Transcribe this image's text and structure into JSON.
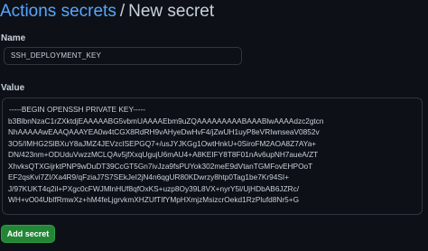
{
  "header": {
    "breadcrumb_link": "Actions secrets",
    "separator": "/",
    "current_page": "New secret"
  },
  "form": {
    "name_label": "Name",
    "name_value": "SSH_DEPLOYMENT_KEY",
    "value_label": "Value",
    "value_lines": [
      "-----BEGIN OPENSSH PRIVATE KEY-----",
      "b3BlbnNzaC1rZXktdjEAAAAABG5vbmUAAAAEbm9uZQAAAAAAAAABAAABlwAAAAdzc2gtcn",
      "NhAAAAAwEAAQAAAYEA0w4tCGX8RdRH9vAHyeDwHvF4/jZwUH1uyP8eVRIwnseaV0852v",
      "3O5/IMHG2SlBXuY8aJMZ4JEVzcISEPGQ7+/usJYJKGg1OwtHnkU+0SiroFM2AOA8Z7AYa+",
      "DN/423nm+ODUduVwzzMCLQAv5jfXxqUgujU6mAU4+A8KEIFY8T8F01nAv6upNH7aueA/ZT",
      "XhvksQTXGijrktPNP9wDuDT39CcGT5Gn7ivJza9fsPUYok302meE9dVtanTGMFovEHPOoT",
      "EF2qsKvi7ZI/Xa4R9/qFziaJ7S7SEkJeI2jN4n6qgUR80KDwrzy8htp0Tag1be7Kr94SI+",
      "J/97KUKT4q2il+PXgc0cFWJMlnHUf8qfOxKS+uzp8Oy39L8VX+nyrY5l/UjHDbAB6JZRc/",
      "WH+vO04UbIfRmwXz+hM4feLjgrvkmXHZUfTIfYMpHXmjzMsizcrOekd1RzPlufd8Nr5+G"
    ]
  },
  "actions": {
    "add_secret_label": "Add secret"
  },
  "colors": {
    "background": "#0d1117",
    "link": "#58a6ff",
    "text": "#c9d1d9",
    "border": "#30363d",
    "button": "#238636"
  }
}
